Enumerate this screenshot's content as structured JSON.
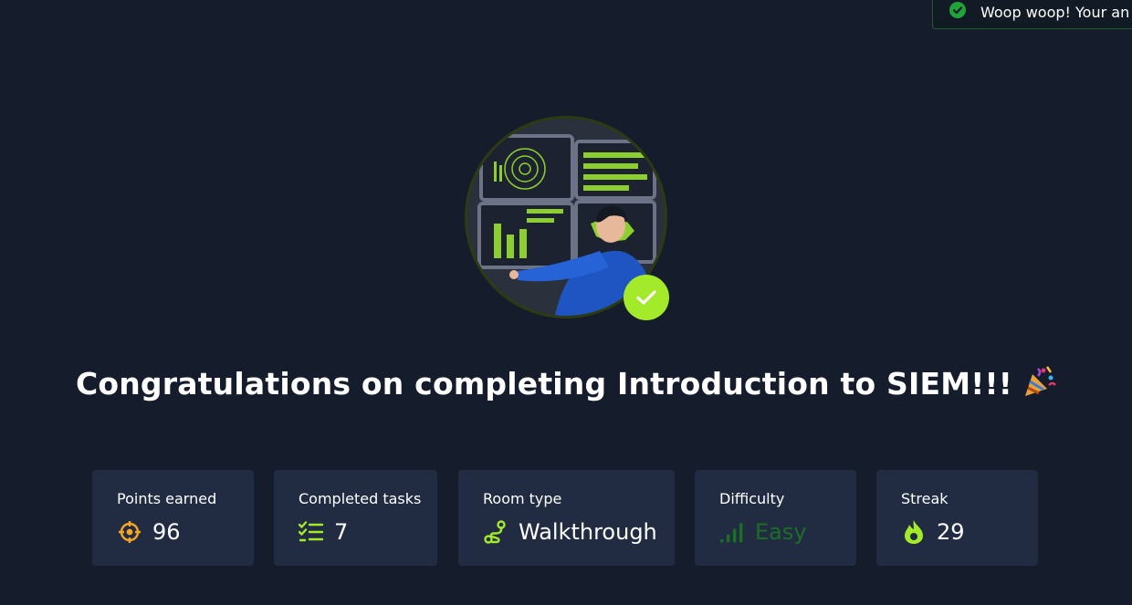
{
  "toast": {
    "message": "Woop woop! Your an"
  },
  "title": "Congratulations on completing Introduction to SIEM!!!",
  "stats": [
    {
      "label": "Points earned",
      "value": "96",
      "icon": "crosshair-icon"
    },
    {
      "label": "Completed tasks",
      "value": "7",
      "icon": "task-list-icon"
    },
    {
      "label": "Room type",
      "value": "Walkthrough",
      "icon": "route-icon"
    },
    {
      "label": "Difficulty",
      "value": "Easy",
      "icon": "signal-bars-icon"
    },
    {
      "label": "Streak",
      "value": "29",
      "icon": "flame-icon"
    }
  ],
  "colors": {
    "background": "#151c2b",
    "card": "#212c42",
    "accent_green": "#a3ea2a",
    "points_orange": "#f5a623",
    "easy_green": "#1b6e25"
  }
}
